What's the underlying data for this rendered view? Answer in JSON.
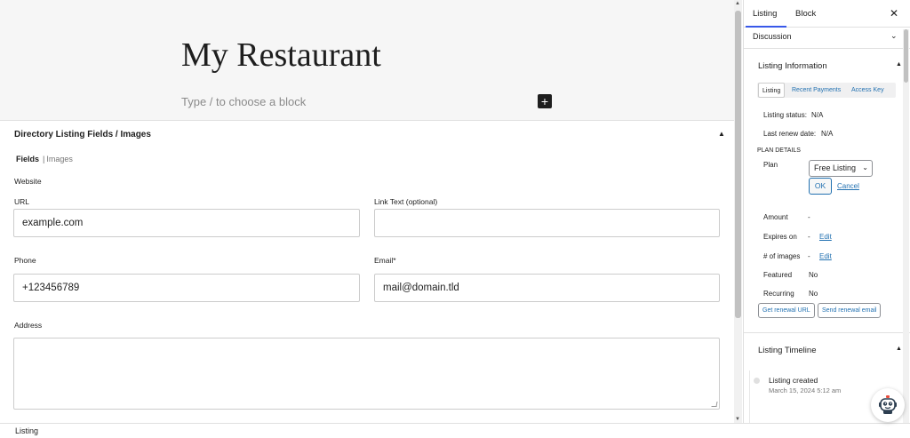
{
  "editor": {
    "post_title": "My Restaurant",
    "block_placeholder": "Type / to choose a block",
    "add_block_symbol": "+"
  },
  "metabox": {
    "title": "Directory Listing Fields / Images",
    "subtabs": {
      "fields": "Fields",
      "separator": "|",
      "images": "Images"
    },
    "website_label": "Website",
    "url_label": "URL",
    "url_value": "example.com",
    "link_text_label": "Link Text (optional)",
    "link_text_value": "",
    "phone_label": "Phone",
    "phone_value": "+123456789",
    "email_label": "Email*",
    "email_value": "mail@domain.tld",
    "address_label": "Address",
    "address_value": ""
  },
  "footer": {
    "breadcrumb": "Listing"
  },
  "sidebar": {
    "tabs": [
      "Listing",
      "Block"
    ],
    "discussion_title": "Discussion",
    "listing_info": {
      "title": "Listing Information",
      "tabs": [
        "Listing",
        "Recent Payments",
        "Access Key"
      ],
      "status_label": "Listing status:",
      "status_value": "N/A",
      "renew_label": "Last renew date:",
      "renew_value": "N/A",
      "plan_details_heading": "PLAN DETAILS",
      "plan_label": "Plan",
      "plan_selected": "Free Listing",
      "ok_label": "OK",
      "cancel_label": "Cancel",
      "amount_label": "Amount",
      "amount_value": "-",
      "expires_label": "Expires on",
      "expires_value": "-",
      "images_label": "# of images",
      "images_value": "-",
      "edit_label": "Edit",
      "featured_label": "Featured",
      "featured_value": "No",
      "recurring_label": "Recurring",
      "recurring_value": "No",
      "renewal_url_button": "Get renewal URL",
      "renewal_email_button": "Send renewal email"
    },
    "timeline": {
      "title": "Listing Timeline",
      "event_title": "Listing created",
      "event_date": "March 15, 2024 5:12 am"
    }
  },
  "colors": {
    "accent": "#3858e9",
    "link": "#2271b1"
  }
}
